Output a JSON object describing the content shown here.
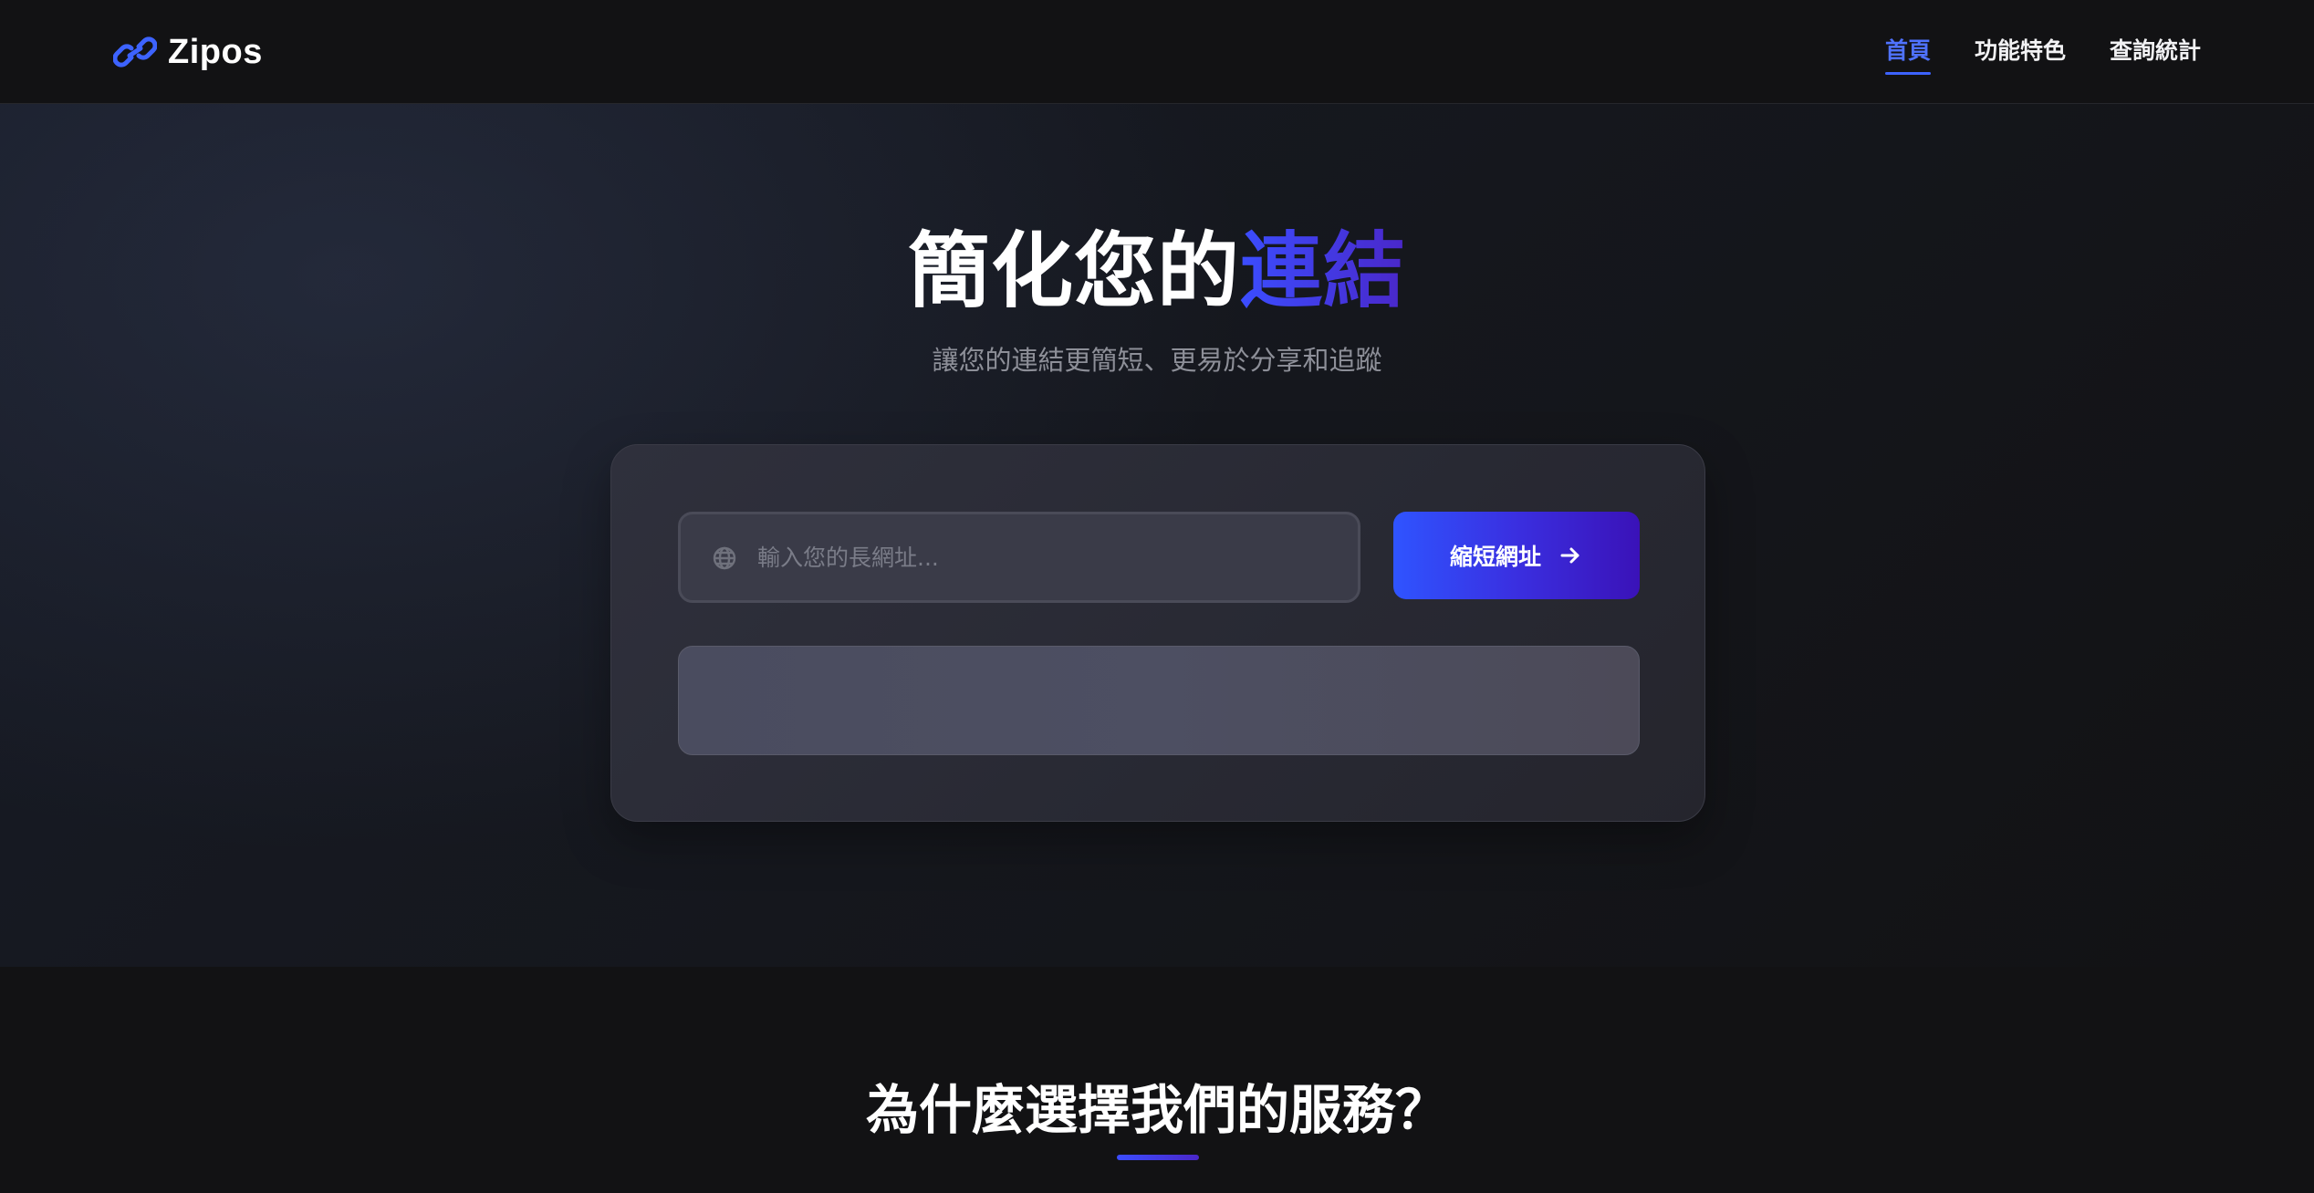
{
  "brand": {
    "name": "Zipos",
    "icon": "link-icon",
    "accent_color": "#3d63ff"
  },
  "nav": {
    "items": [
      {
        "label": "首頁",
        "active": true
      },
      {
        "label": "功能特色",
        "active": false
      },
      {
        "label": "查詢統計",
        "active": false
      }
    ]
  },
  "hero": {
    "title_main": "簡化您的",
    "title_accent": "連結",
    "subtitle": "讓您的連結更簡短、更易於分享和追蹤"
  },
  "shortener": {
    "input_icon": "globe-icon",
    "placeholder": "輸入您的長網址...",
    "value": "",
    "button_label": "縮短網址",
    "button_icon": "arrow-right-icon"
  },
  "features": {
    "title": "為什麼選擇我們的服務？"
  }
}
